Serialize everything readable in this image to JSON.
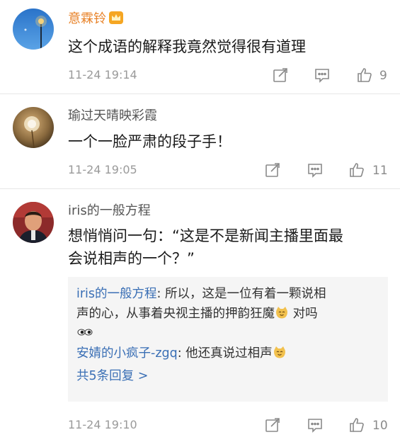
{
  "comments": [
    {
      "username": "意霖铃",
      "text": "这个成语的解释我竟然觉得很有道理",
      "time": "11-24 19:14",
      "likes": "9"
    },
    {
      "username": "瑜过天晴映彩霞",
      "text": "一个一脸严肃的段子手！",
      "time": "11-24 19:05",
      "likes": "11"
    },
    {
      "username": "iris的一般方程",
      "text_line1": "想悄悄问一句：“这是不是新闻主播里面最",
      "text_line2": "会说相声的一个？”",
      "time": "11-24 19:10",
      "likes": "10",
      "replies": [
        {
          "user": "iris的一般方程",
          "text_line1": ": 所以，这是一位有着一颗说相",
          "text_line2": "声的心，从事着央视主播的押韵狂魔",
          "text_after_emoji": " 对吗"
        },
        {
          "user": "安婧的小疯子-zgq",
          "text": ": 他还真说过相声"
        }
      ],
      "more_replies": "共5条回复 >"
    }
  ],
  "icons": {
    "repost": "repost-icon",
    "comment": "comment-icon",
    "like": "thumbs-up-icon",
    "vip": "crown-icon",
    "emoji": "cat-emoji-icon",
    "eyes": "eyes-emoji-icon"
  },
  "colors": {
    "vip_username": "#e8832a",
    "link_blue": "#3a6fb5",
    "meta_gray": "#9a9a9a"
  }
}
